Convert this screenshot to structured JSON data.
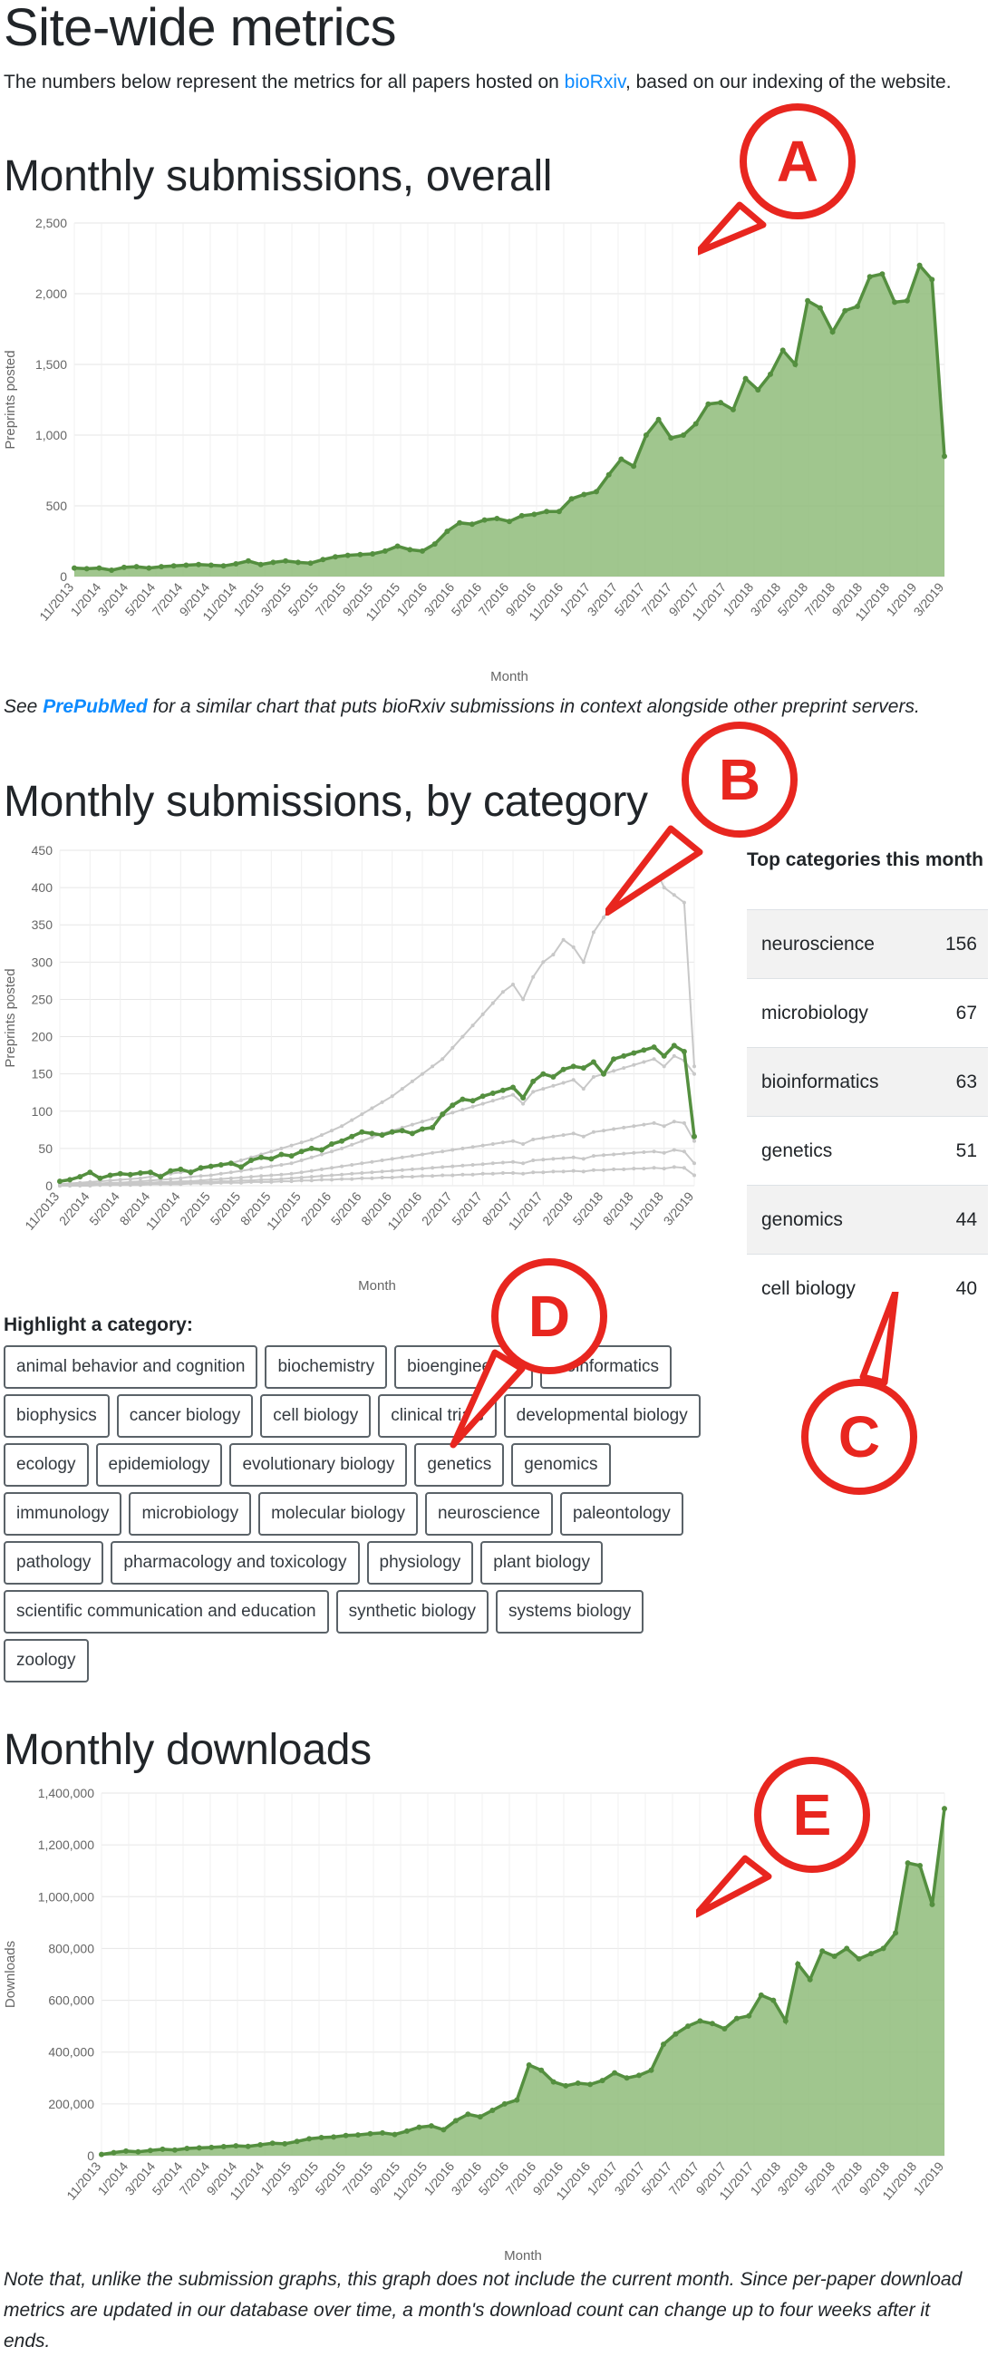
{
  "page": {
    "title": "Site-wide metrics",
    "intro_before": "The numbers below represent the metrics for all papers hosted on ",
    "intro_link": "bioRxiv",
    "intro_after": ", based on our indexing of the website."
  },
  "sections": {
    "overall_title": "Monthly submissions, overall",
    "category_title": "Monthly submissions, by category",
    "downloads_title": "Monthly downloads"
  },
  "notes": {
    "prepubmed_before": "See ",
    "prepubmed_link": "PrePubMed",
    "prepubmed_after": " for a similar chart that puts bioRxiv submissions in context alongside other preprint servers.",
    "downloads_note": "Note that, unlike the submission graphs, this graph does not include the current month. Since per-paper download metrics are updated in our database over time, a month's download count can change up to four weeks after it ends."
  },
  "top_categories": {
    "title": "Top categories this month",
    "rows": [
      {
        "name": "neuroscience",
        "count": "156"
      },
      {
        "name": "microbiology",
        "count": "67"
      },
      {
        "name": "bioinformatics",
        "count": "63"
      },
      {
        "name": "genetics",
        "count": "51"
      },
      {
        "name": "genomics",
        "count": "44"
      },
      {
        "name": "cell biology",
        "count": "40"
      }
    ]
  },
  "highlight": {
    "label": "Highlight a category:",
    "categories": [
      "animal behavior and cognition",
      "biochemistry",
      "bioengineering",
      "bioinformatics",
      "biophysics",
      "cancer biology",
      "cell biology",
      "clinical trials",
      "developmental biology",
      "ecology",
      "epidemiology",
      "evolutionary biology",
      "genetics",
      "genomics",
      "immunology",
      "microbiology",
      "molecular biology",
      "neuroscience",
      "paleontology",
      "pathology",
      "pharmacology and toxicology",
      "physiology",
      "plant biology",
      "scientific communication and education",
      "synthetic biology",
      "systems biology",
      "zoology"
    ]
  },
  "callouts": [
    "A",
    "B",
    "C",
    "D",
    "E"
  ],
  "colors": {
    "series_green": "#548f3f",
    "fill_green": "#8fbc7a",
    "grey_series": "#c8c8c8",
    "link": "#0d8bff",
    "callout_red": "#e8261f"
  },
  "chart_data": [
    {
      "type": "area",
      "title": "",
      "xlabel": "Month",
      "ylabel": "Preprints posted",
      "ylim": [
        0,
        2500
      ],
      "yticks": [
        "0",
        "500",
        "1,000",
        "1,500",
        "2,000",
        "2,500"
      ],
      "x_tick_labels": [
        "11/2013",
        "1/2014",
        "3/2014",
        "5/2014",
        "7/2014",
        "9/2014",
        "11/2014",
        "1/2015",
        "3/2015",
        "5/2015",
        "7/2015",
        "9/2015",
        "11/2015",
        "1/2016",
        "3/2016",
        "5/2016",
        "7/2016",
        "9/2016",
        "11/2016",
        "1/2017",
        "3/2017",
        "5/2017",
        "7/2017",
        "9/2017",
        "11/2017",
        "1/2018",
        "3/2018",
        "5/2018",
        "7/2018",
        "9/2018",
        "11/2018",
        "1/2019",
        "3/2019"
      ],
      "series": [
        {
          "values": [
            60,
            55,
            60,
            45,
            65,
            70,
            60,
            70,
            75,
            80,
            85,
            80,
            75,
            90,
            110,
            85,
            100,
            110,
            100,
            95,
            120,
            140,
            150,
            155,
            160,
            180,
            215,
            190,
            180,
            230,
            320,
            380,
            370,
            400,
            410,
            390,
            430,
            440,
            460,
            460,
            550,
            580,
            600,
            720,
            830,
            780,
            1000,
            1110,
            980,
            1000,
            1080,
            1220,
            1230,
            1180,
            1400,
            1320,
            1430,
            1600,
            1500,
            1950,
            1900,
            1730,
            1880,
            1910,
            2120,
            2140,
            1940,
            1950,
            2200,
            2100,
            850
          ]
        }
      ]
    },
    {
      "type": "line",
      "title": "",
      "xlabel": "Month",
      "ylabel": "Preprints posted",
      "ylim": [
        0,
        450
      ],
      "yticks": [
        "0",
        "50",
        "100",
        "150",
        "200",
        "250",
        "300",
        "350",
        "400",
        "450"
      ],
      "x_tick_labels": [
        "11/2013",
        "2/2014",
        "5/2014",
        "8/2014",
        "11/2014",
        "2/2015",
        "5/2015",
        "8/2015",
        "11/2015",
        "2/2016",
        "5/2016",
        "8/2016",
        "11/2016",
        "2/2017",
        "5/2017",
        "8/2017",
        "11/2017",
        "2/2018",
        "5/2018",
        "8/2018",
        "11/2018",
        "3/2019"
      ],
      "series": [
        {
          "values": [
            6,
            8,
            12,
            18,
            10,
            14,
            16,
            15,
            17,
            18,
            12,
            20,
            22,
            18,
            24,
            26,
            28,
            30,
            25,
            34,
            38,
            36,
            42,
            40,
            46,
            50,
            48,
            56,
            60,
            66,
            72,
            70,
            68,
            72,
            74,
            70,
            76,
            78,
            96,
            108,
            116,
            114,
            120,
            124,
            128,
            132,
            118,
            140,
            150,
            146,
            156,
            160,
            158,
            166,
            150,
            170,
            174,
            178,
            182,
            186,
            174,
            188,
            180,
            66
          ],
          "highlight": true
        },
        {
          "values": [
            2,
            3,
            4,
            5,
            6,
            7,
            8,
            9,
            10,
            12,
            14,
            16,
            18,
            20,
            22,
            25,
            28,
            30,
            34,
            38,
            42,
            46,
            50,
            54,
            58,
            62,
            68,
            74,
            80,
            88,
            96,
            104,
            112,
            120,
            130,
            140,
            150,
            160,
            170,
            185,
            200,
            215,
            230,
            245,
            260,
            270,
            250,
            280,
            300,
            310,
            330,
            320,
            300,
            340,
            360,
            380,
            400,
            390,
            420,
            430,
            400,
            390,
            380,
            160
          ]
        },
        {
          "values": [
            1,
            2,
            2,
            3,
            3,
            4,
            4,
            5,
            6,
            7,
            8,
            9,
            10,
            12,
            13,
            14,
            16,
            18,
            20,
            22,
            24,
            26,
            28,
            30,
            34,
            38,
            42,
            46,
            50,
            55,
            60,
            65,
            70,
            74,
            78,
            82,
            86,
            90,
            94,
            98,
            102,
            106,
            110,
            114,
            118,
            122,
            110,
            126,
            130,
            134,
            138,
            142,
            130,
            146,
            150,
            154,
            158,
            162,
            166,
            170,
            160,
            174,
            168,
            150
          ]
        },
        {
          "values": [
            0,
            1,
            1,
            1,
            2,
            2,
            3,
            3,
            4,
            4,
            5,
            5,
            6,
            6,
            7,
            8,
            9,
            10,
            11,
            12,
            13,
            14,
            15,
            16,
            18,
            20,
            22,
            24,
            26,
            28,
            30,
            32,
            34,
            36,
            38,
            40,
            42,
            44,
            46,
            48,
            50,
            52,
            54,
            56,
            58,
            60,
            56,
            62,
            64,
            66,
            68,
            70,
            66,
            72,
            74,
            76,
            78,
            80,
            82,
            84,
            80,
            86,
            84,
            60
          ]
        },
        {
          "values": [
            0,
            0,
            1,
            1,
            1,
            1,
            2,
            2,
            2,
            3,
            3,
            3,
            4,
            4,
            5,
            5,
            6,
            6,
            7,
            7,
            8,
            8,
            9,
            10,
            11,
            12,
            13,
            14,
            15,
            16,
            17,
            18,
            19,
            20,
            21,
            22,
            23,
            24,
            25,
            26,
            27,
            28,
            29,
            30,
            31,
            32,
            30,
            34,
            35,
            36,
            37,
            38,
            36,
            40,
            41,
            42,
            43,
            44,
            45,
            46,
            44,
            48,
            46,
            30
          ]
        },
        {
          "values": [
            0,
            0,
            0,
            0,
            1,
            1,
            1,
            1,
            1,
            2,
            2,
            2,
            2,
            3,
            3,
            3,
            4,
            4,
            4,
            5,
            5,
            5,
            6,
            6,
            7,
            7,
            8,
            8,
            9,
            9,
            10,
            10,
            11,
            11,
            12,
            12,
            13,
            13,
            14,
            14,
            15,
            15,
            16,
            16,
            17,
            17,
            16,
            18,
            18,
            19,
            19,
            20,
            19,
            21,
            21,
            22,
            22,
            23,
            23,
            24,
            23,
            25,
            24,
            14
          ]
        }
      ]
    },
    {
      "type": "area",
      "title": "",
      "xlabel": "Month",
      "ylabel": "Downloads",
      "ylim": [
        0,
        1400000
      ],
      "yticks": [
        "0",
        "200,000",
        "400,000",
        "600,000",
        "800,000",
        "1,000,000",
        "1,200,000",
        "1,400,000"
      ],
      "x_tick_labels": [
        "11/2013",
        "1/2014",
        "3/2014",
        "5/2014",
        "7/2014",
        "9/2014",
        "11/2014",
        "1/2015",
        "3/2015",
        "5/2015",
        "7/2015",
        "9/2015",
        "11/2015",
        "1/2016",
        "3/2016",
        "5/2016",
        "7/2016",
        "9/2016",
        "11/2016",
        "1/2017",
        "3/2017",
        "5/2017",
        "7/2017",
        "9/2017",
        "11/2017",
        "1/2018",
        "3/2018",
        "5/2018",
        "7/2018",
        "9/2018",
        "11/2018",
        "1/2019"
      ],
      "series": [
        {
          "values": [
            5000,
            12000,
            18000,
            15000,
            20000,
            25000,
            22000,
            28000,
            30000,
            32000,
            35000,
            38000,
            36000,
            42000,
            48000,
            46000,
            55000,
            65000,
            70000,
            72000,
            78000,
            80000,
            85000,
            88000,
            82000,
            95000,
            110000,
            115000,
            100000,
            135000,
            160000,
            150000,
            175000,
            200000,
            215000,
            350000,
            330000,
            285000,
            270000,
            280000,
            275000,
            290000,
            320000,
            300000,
            310000,
            330000,
            430000,
            470000,
            500000,
            520000,
            510000,
            490000,
            530000,
            540000,
            620000,
            600000,
            520000,
            740000,
            680000,
            790000,
            770000,
            800000,
            760000,
            780000,
            800000,
            860000,
            1130000,
            1120000,
            970000,
            1340000
          ]
        }
      ]
    }
  ]
}
